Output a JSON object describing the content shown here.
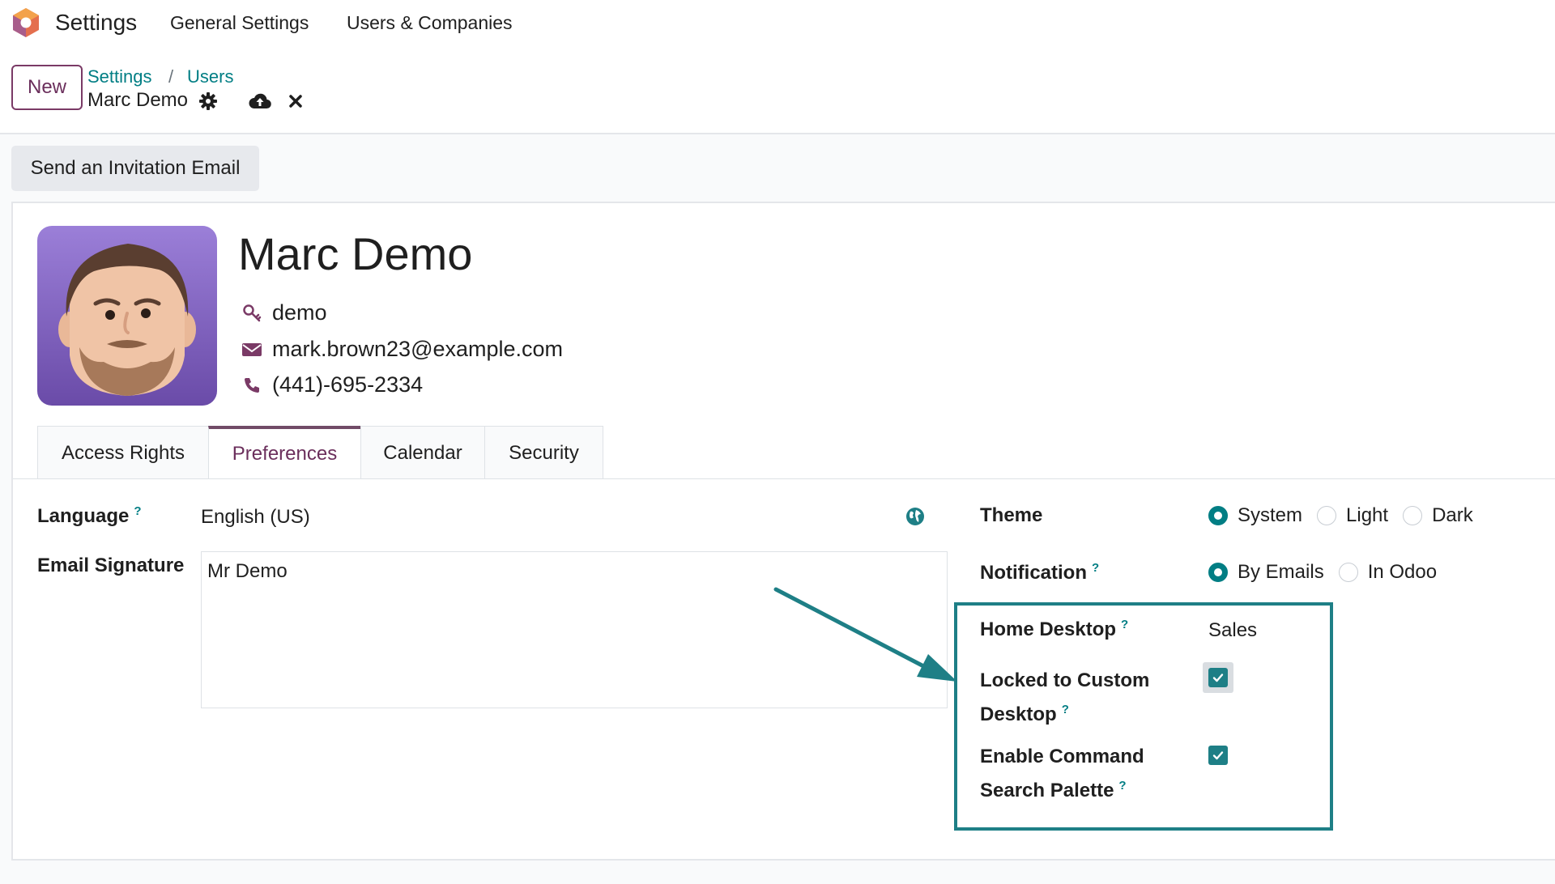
{
  "nav": {
    "app_title": "Settings",
    "menu": [
      "General Settings",
      "Users & Companies"
    ]
  },
  "control": {
    "new_label": "New",
    "breadcrumb": [
      "Settings",
      "Users"
    ],
    "breadcrumb_sep": "/",
    "record_name": "Marc Demo"
  },
  "actions": {
    "invite_label": "Send an Invitation Email"
  },
  "user": {
    "name": "Marc Demo",
    "login": "demo",
    "email": "mark.brown23@example.com",
    "phone": "(441)-695-2334"
  },
  "tabs": [
    {
      "label": "Access Rights",
      "active": false
    },
    {
      "label": "Preferences",
      "active": true
    },
    {
      "label": "Calendar",
      "active": false
    },
    {
      "label": "Security",
      "active": false
    }
  ],
  "preferences": {
    "language_label": "Language",
    "language_value": "English (US)",
    "signature_label": "Email Signature",
    "signature_value": "Mr Demo",
    "help_mark": "?",
    "theme_label": "Theme",
    "theme_options": [
      "System",
      "Light",
      "Dark"
    ],
    "theme_selected": "System",
    "notification_label": "Notification",
    "notification_options": [
      "By Emails",
      "In Odoo"
    ],
    "notification_selected": "By Emails",
    "home_desktop_label": "Home Desktop",
    "home_desktop_value": "Sales",
    "locked_label_line1": "Locked to Custom",
    "locked_label_line2": "Desktop",
    "locked_checked": true,
    "palette_label_line1": "Enable Command",
    "palette_label_line2": "Search Palette",
    "palette_checked": true
  },
  "colors": {
    "brand": "#714b67",
    "accent": "#017e84",
    "highlight": "#1e7f86"
  },
  "icons": {
    "logo": "odoo-logo-icon",
    "gear": "gear-icon",
    "save": "cloud-upload-icon",
    "discard": "close-icon",
    "login": "key-icon",
    "email": "envelope-icon",
    "phone": "phone-icon",
    "globe": "globe-icon"
  }
}
